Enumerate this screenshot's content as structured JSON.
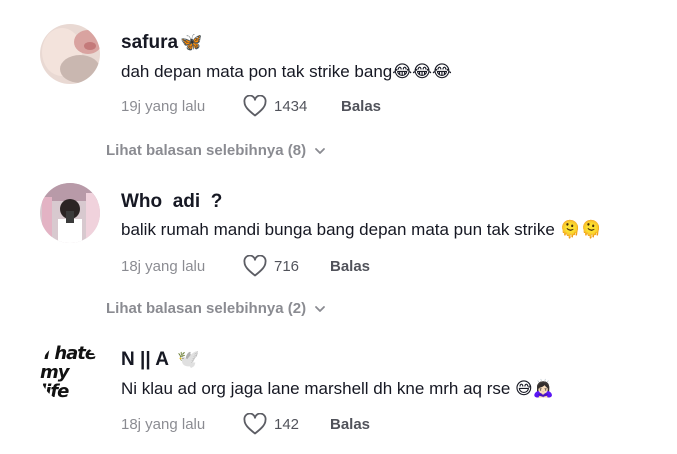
{
  "comments": [
    {
      "username": "safura",
      "username_emoji": "🦋",
      "text": "dah depan mata pon tak strike bang😂😂😂",
      "time": "19j yang lalu",
      "likes": "1434",
      "reply_label": "Balas",
      "more_replies": "Lihat balasan selebihnya (8)"
    },
    {
      "username": "Who  adi  ?",
      "username_emoji": "",
      "text": "balik rumah mandi bunga bang depan mata pun tak strike 🫠🫠",
      "time": "18j yang lalu",
      "likes": "716",
      "reply_label": "Balas",
      "more_replies": "Lihat balasan selebihnya (2)"
    },
    {
      "username": "N || A",
      "username_emoji": "🕊️",
      "text": "Ni klau ad org jaga lane marshell dh kne mrh aq rse 😅🙇🏻‍♀️",
      "time": "18j yang lalu",
      "likes": "142",
      "reply_label": "Balas",
      "avatar_text_line1": "i hate",
      "avatar_text_line2": "my life"
    }
  ],
  "icons": [
    "heart-icon",
    "chevron-down-icon"
  ],
  "colors": {
    "text": "#161823",
    "muted": "#8a8b91"
  }
}
